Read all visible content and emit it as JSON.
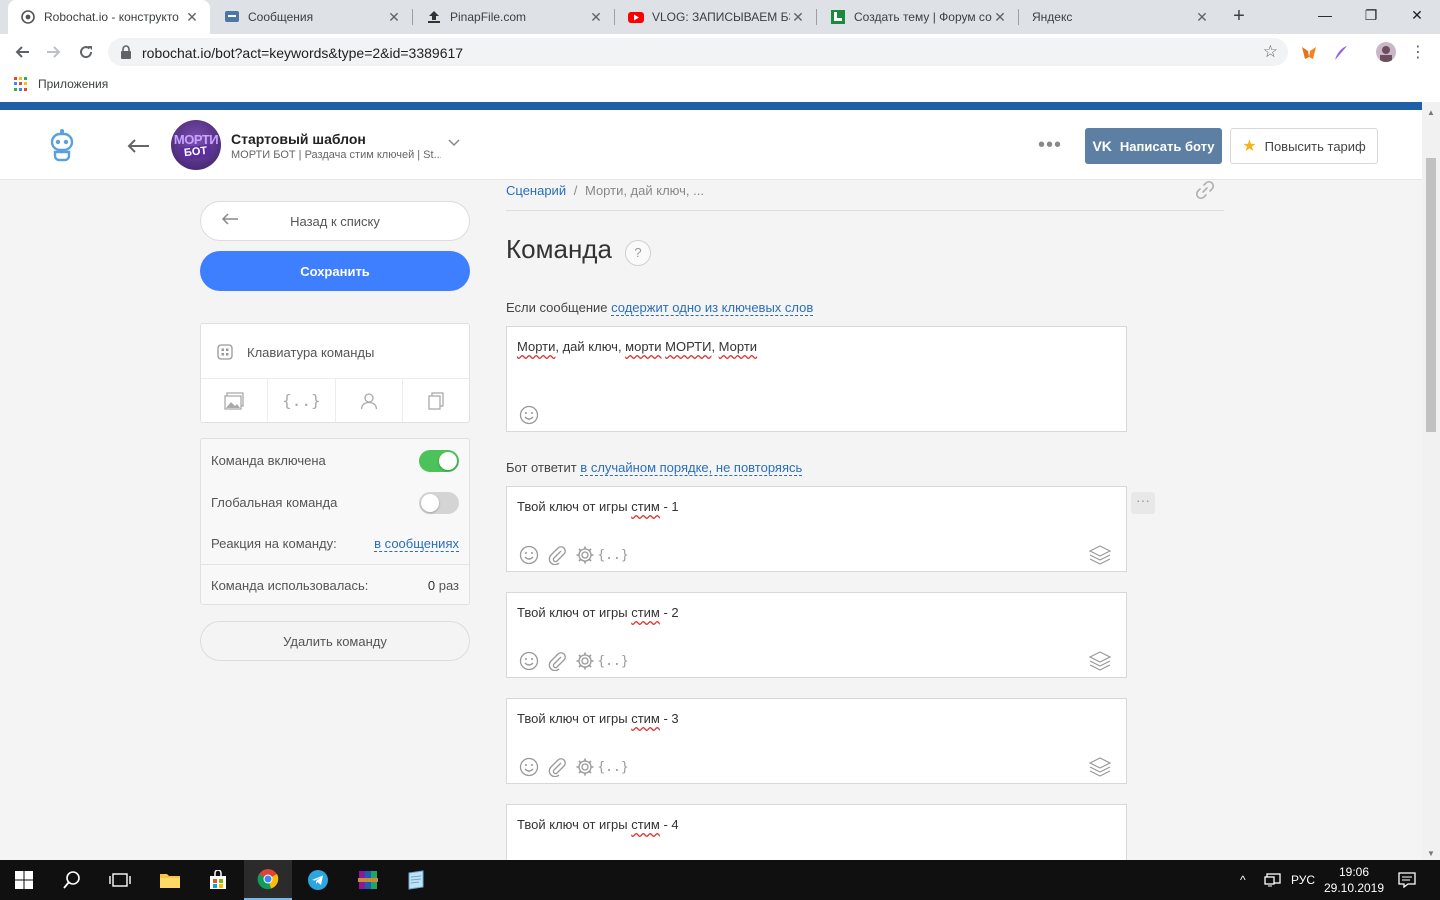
{
  "browser": {
    "tabs": [
      {
        "title": "Robochat.io - конструкто",
        "icon": "robochat-icon",
        "active": true
      },
      {
        "title": "Сообщения",
        "icon": "vk-icon",
        "active": false
      },
      {
        "title": "PinapFile.com",
        "icon": "upload-icon",
        "active": false
      },
      {
        "title": "VLOG: ЗАПИСЫВАЕМ БЭ",
        "icon": "youtube-icon",
        "active": false
      },
      {
        "title": "Создать тему | Форум со",
        "icon": "forum-icon",
        "active": false
      },
      {
        "title": "Яндекс",
        "icon": "yandex-icon",
        "active": false
      }
    ],
    "url": "robochat.io/bot?act=keywords&type=2&id=3389617",
    "bookmarks_apps": "Приложения"
  },
  "header": {
    "bot_avatar_line1": "МОРТИ",
    "bot_avatar_line2": "БОТ",
    "bot_name": "Стартовый шаблон",
    "bot_description": "МОРТИ БОТ | Раздача стим ключей | St...",
    "write_bot_label": "Написать боту",
    "write_bot_vk": "VK",
    "upgrade_label": "Повысить тариф"
  },
  "sidebar": {
    "back_label": "Назад к списку",
    "save_label": "Сохранить",
    "keyboard_label": "Клавиатура команды",
    "kb_tools": [
      "image-icon",
      "variables-icon",
      "user-icon",
      "copy-icon"
    ],
    "settings": {
      "enabled_label": "Команда включена",
      "enabled": true,
      "global_label": "Глобальная команда",
      "global": false,
      "reaction_label": "Реакция на команду:",
      "reaction_value": "в сообщениях",
      "used_label": "Команда использовалась:",
      "used_count": "0",
      "used_unit": "раз"
    },
    "delete_label": "Удалить команду"
  },
  "main": {
    "breadcrumb_root": "Сценарий",
    "breadcrumb_sep": "/",
    "breadcrumb_current": "Морти, дай ключ, ...",
    "title": "Команда",
    "help": "?",
    "if_label": "Если сообщение",
    "if_condition": "содержит одно из ключевых слов",
    "keywords": [
      {
        "text": "Морти",
        "sq": true
      },
      {
        "text": ", дай ключ, ",
        "sq": false
      },
      {
        "text": "морти",
        "sq": true
      },
      {
        "text": " ",
        "sq": false
      },
      {
        "text": "МОРТИ",
        "sq": true
      },
      {
        "text": ", ",
        "sq": false
      },
      {
        "text": "Морти",
        "sq": true
      }
    ],
    "reply_label": "Бот ответит",
    "reply_mode": "в случайном порядке, не повторяясь",
    "responses": [
      {
        "prefix": "Твой ключ от игры ",
        "word": "стим",
        "suffix": " - 1"
      },
      {
        "prefix": "Твой ключ от игры ",
        "word": "стим",
        "suffix": " - 2"
      },
      {
        "prefix": "Твой ключ от игры ",
        "word": "стим",
        "suffix": " - 3"
      },
      {
        "prefix": "Твой ключ от игры ",
        "word": "стим",
        "suffix": " - 4"
      }
    ],
    "response_more": "···"
  },
  "taskbar": {
    "language": "РУС",
    "time": "19:06",
    "date": "29.10.2019"
  }
}
